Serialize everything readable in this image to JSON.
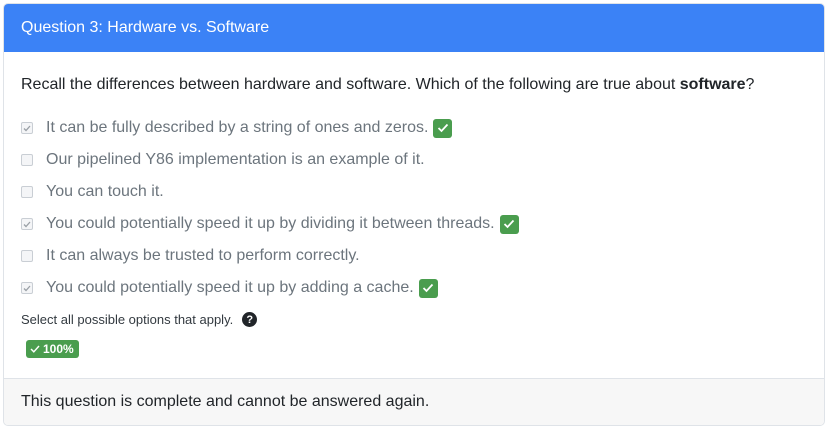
{
  "header": {
    "title": "Question 3: Hardware vs. Software"
  },
  "prompt": {
    "text_before": "Recall the differences between hardware and software. Which of the following are true about ",
    "emphasis": "software",
    "text_after": "?"
  },
  "options": [
    {
      "label": "It can be fully described by a string of ones and zeros.",
      "checked": true,
      "correct_mark": true
    },
    {
      "label": "Our pipelined Y86 implementation is an example of it.",
      "checked": false,
      "correct_mark": false
    },
    {
      "label": "You can touch it.",
      "checked": false,
      "correct_mark": false
    },
    {
      "label": "You could potentially speed it up by dividing it between threads.",
      "checked": true,
      "correct_mark": true
    },
    {
      "label": "It can always be trusted to perform correctly.",
      "checked": false,
      "correct_mark": false
    },
    {
      "label": "You could potentially speed it up by adding a cache.",
      "checked": true,
      "correct_mark": true
    }
  ],
  "hint": {
    "text": "Select all possible options that apply.",
    "icon": "question-circle-icon"
  },
  "score": {
    "label": "100%",
    "icon": "check-icon"
  },
  "footer": {
    "text": "This question is complete and cannot be answered again."
  },
  "colors": {
    "header_bg": "#3b82f6",
    "success": "#4a9d4e",
    "muted_text": "#6c757d"
  }
}
